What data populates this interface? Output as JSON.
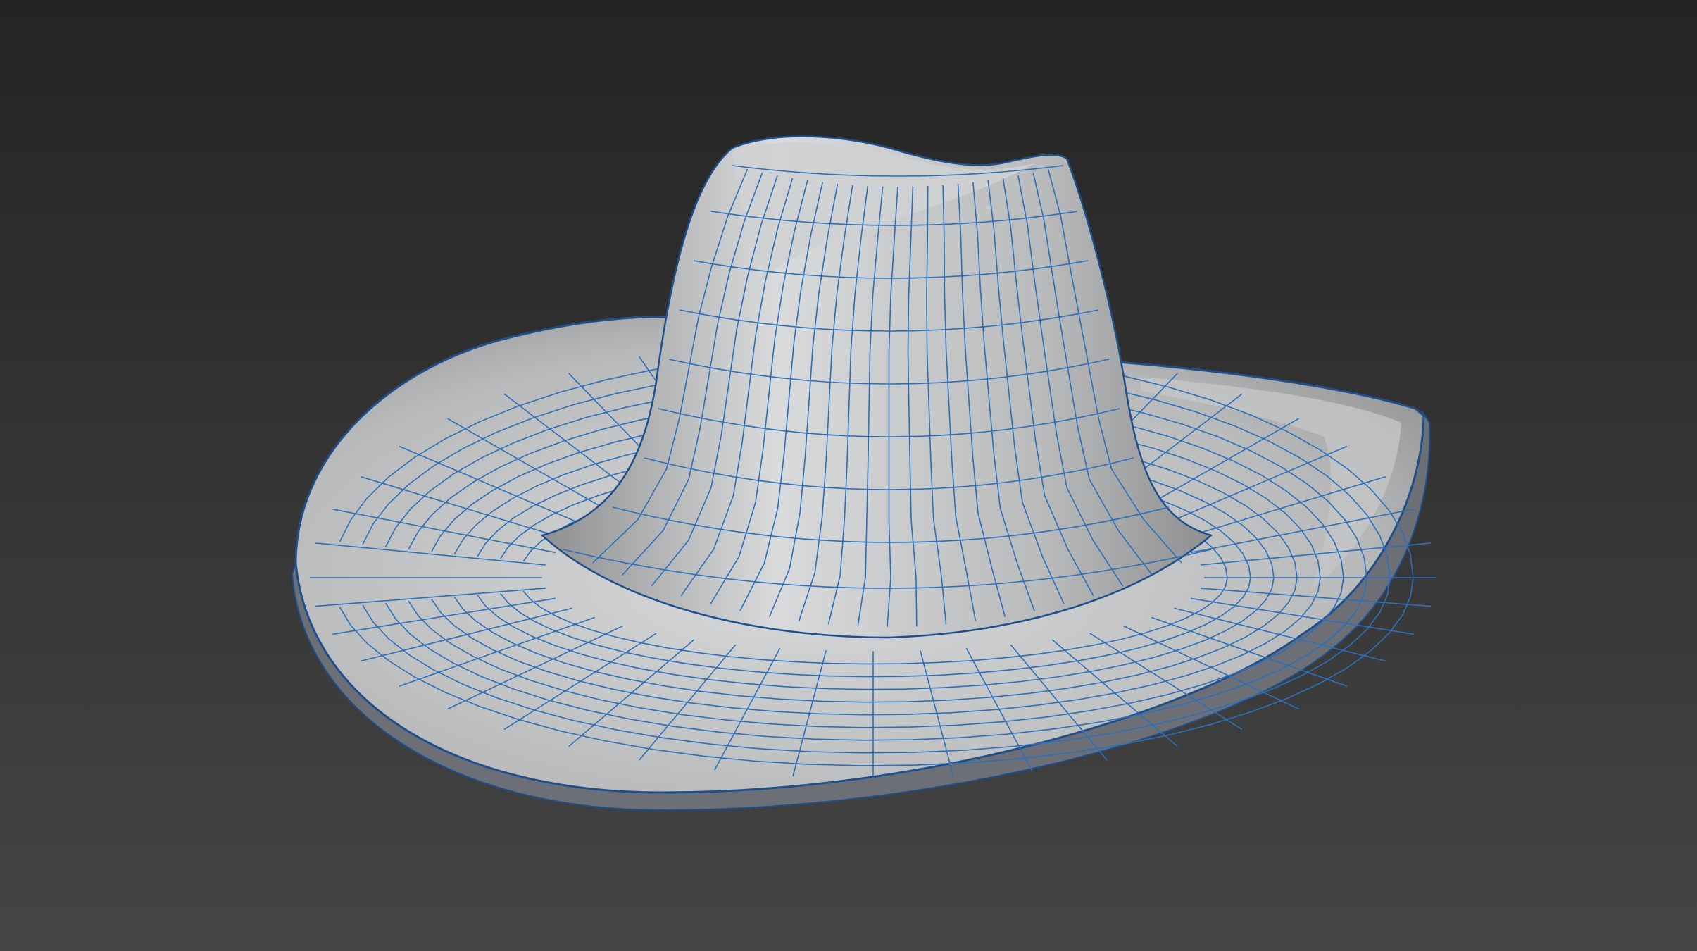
{
  "viewport": {
    "background_top": "#242424",
    "background_bottom": "#454545"
  },
  "model": {
    "object": "hat",
    "display_mode": "shaded-with-wireframe",
    "surface_color_light": "#d9dadb",
    "surface_color_mid": "#b9babb",
    "surface_color_dark": "#8e8f91",
    "wire_color": "#2d6fb8",
    "edge_outline_color": "#1f4f8a"
  }
}
